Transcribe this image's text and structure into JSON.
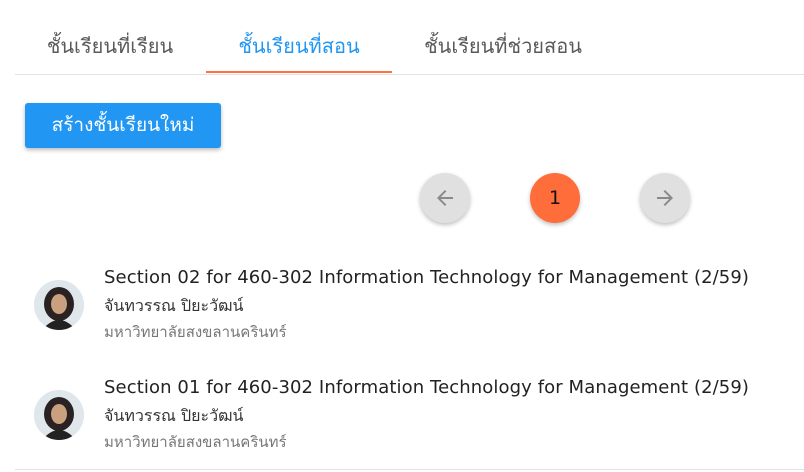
{
  "tabs": [
    {
      "label": "ชั้นเรียนที่เรียน",
      "active": false
    },
    {
      "label": "ชั้นเรียนที่สอน",
      "active": true
    },
    {
      "label": "ชั้นเรียนที่ช่วยสอน",
      "active": false
    }
  ],
  "create_button": {
    "label": "สร้างชั้นเรียนใหม่"
  },
  "pagination": {
    "current_page": "1",
    "prev_icon": "arrow-left-icon",
    "next_icon": "arrow-right-icon"
  },
  "classes": [
    {
      "title": "Section 02 for 460-302 Information Technology for Management (2/59)",
      "teacher": "จันทวรรณ ปิยะวัฒน์",
      "school": "มหาวิทยาลัยสงขลานครินทร์"
    },
    {
      "title": "Section 01 for 460-302 Information Technology for Management (2/59)",
      "teacher": "จันทวรรณ ปิยะวัฒน์",
      "school": "มหาวิทยาลัยสงขลานครินทร์"
    }
  ],
  "colors": {
    "accent": "#2196f3",
    "active_tab_underline": "#ff7043",
    "current_page": "#ff6d3a"
  }
}
